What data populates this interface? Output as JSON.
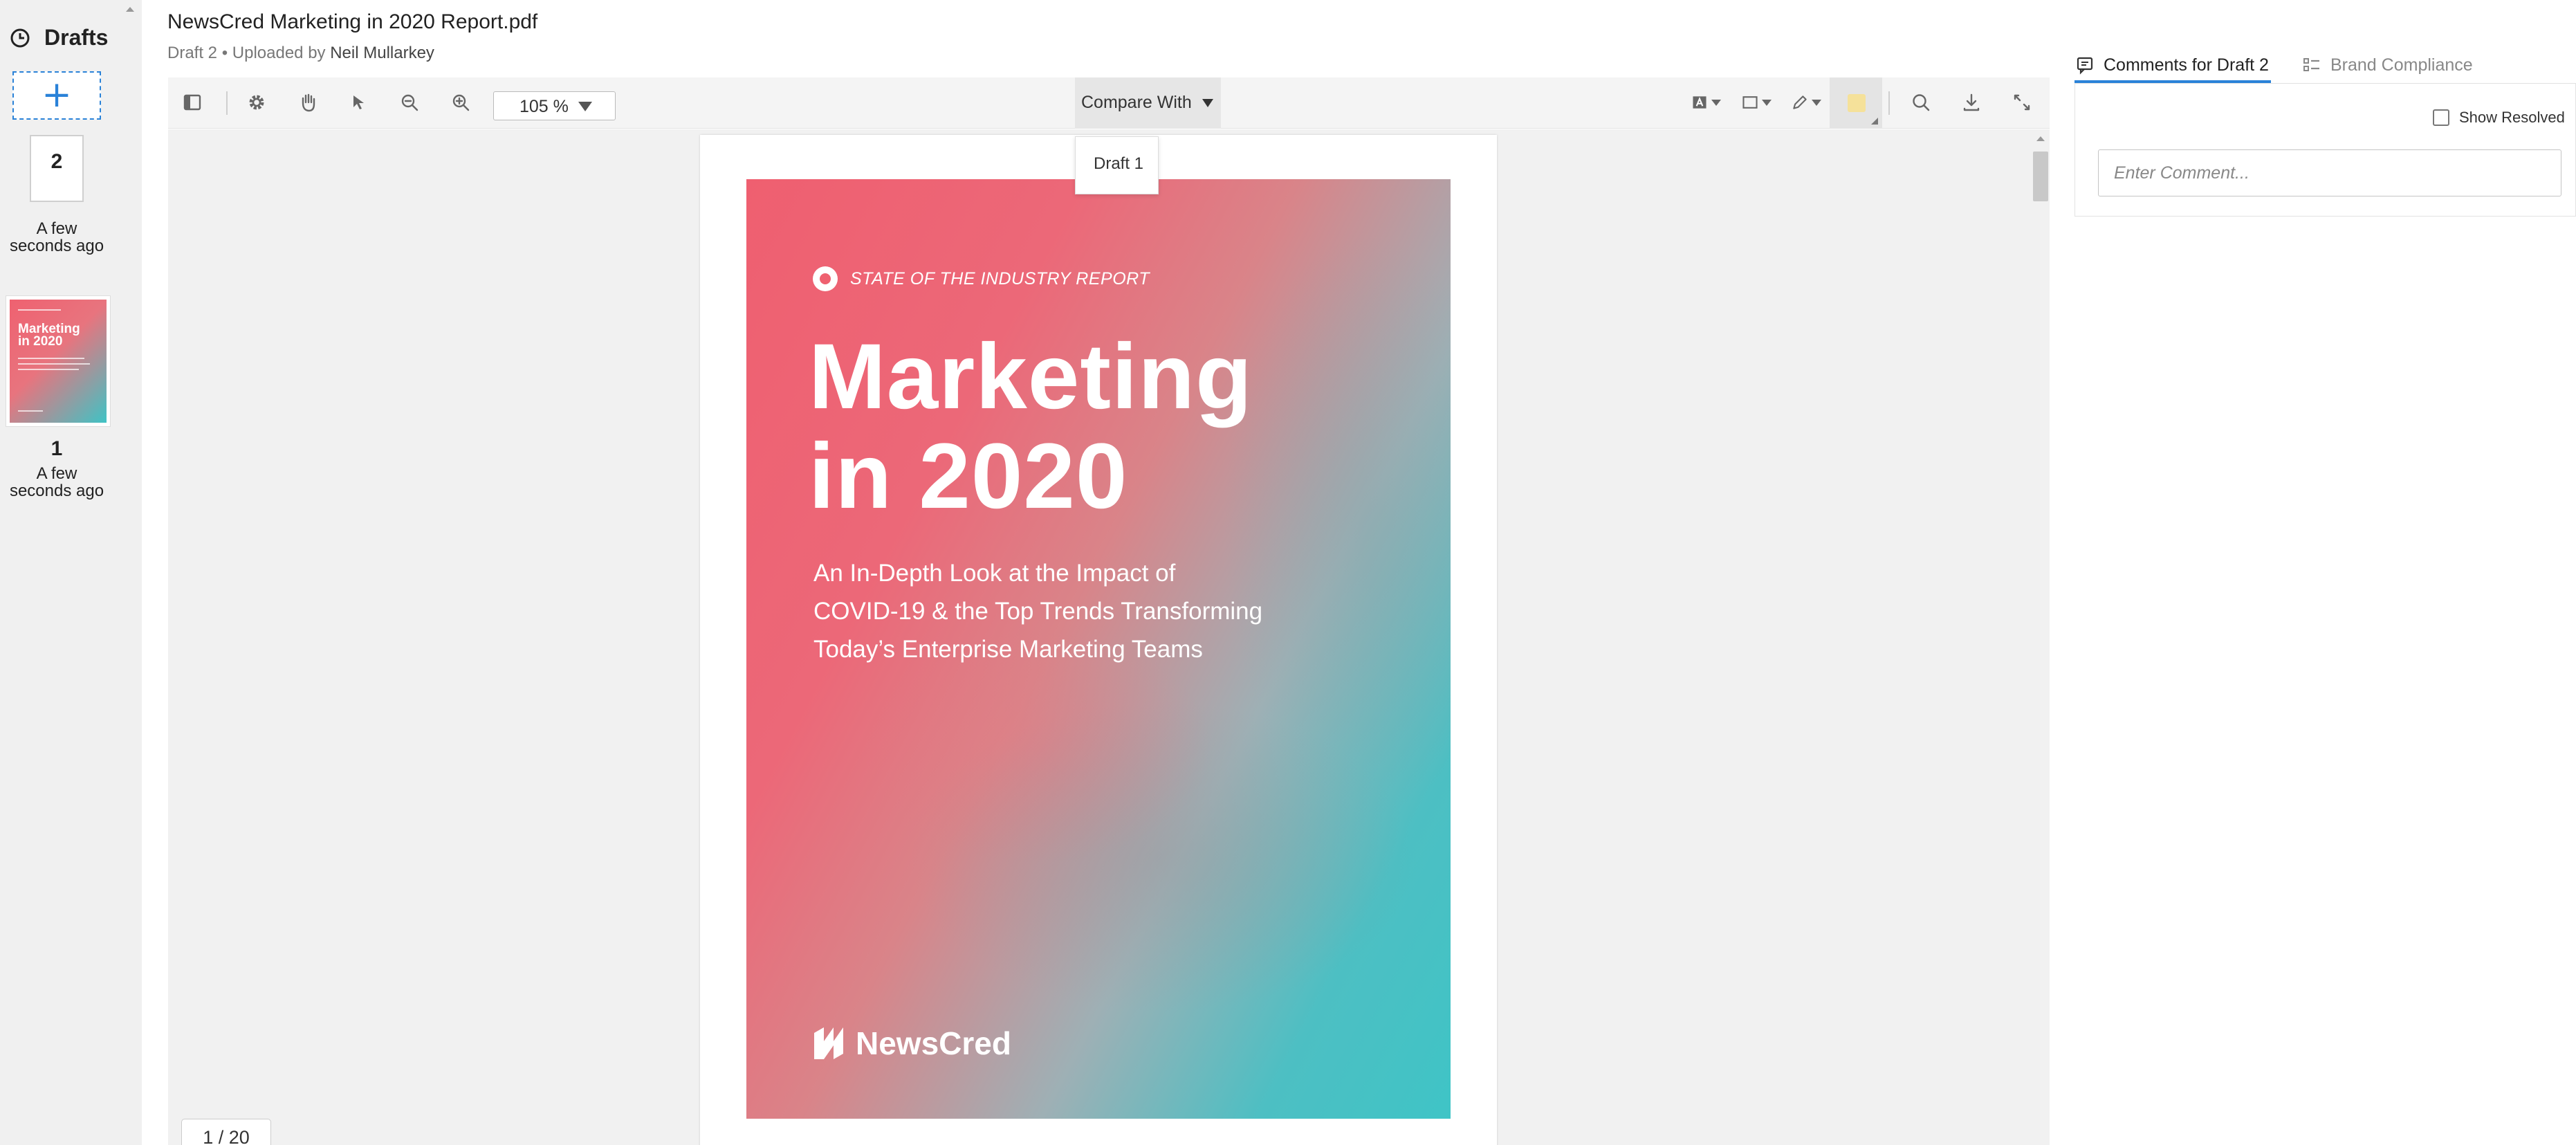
{
  "file": {
    "title": "NewsCred Marketing in 2020 Report.pdf",
    "draft_label": "Draft 2",
    "uploaded_by_prefix": "• Uploaded by",
    "uploader": "Neil Mullarkey"
  },
  "sidebar": {
    "title": "Drafts",
    "add_label": "+",
    "drafts": [
      {
        "number": "2",
        "time_line1": "A few",
        "time_line2": "seconds ago"
      },
      {
        "number": "1",
        "time_line1": "A few",
        "time_line2": "seconds ago"
      }
    ]
  },
  "toolbar": {
    "zoom": "105 %",
    "compare_label": "Compare With",
    "compare_options": [
      "Draft 1"
    ],
    "icons": [
      "sidebar-toggle-icon",
      "gear-icon",
      "hand-icon",
      "pointer-icon",
      "zoom-out-icon",
      "zoom-in-icon",
      "text-tool-icon",
      "shape-tool-icon",
      "pen-tool-icon",
      "highlight-icon",
      "search-icon",
      "download-icon",
      "fullscreen-icon"
    ]
  },
  "document": {
    "kicker": "STATE OF THE INDUSTRY REPORT",
    "headline_line1": "Marketing",
    "headline_line2": "in 2020",
    "subtitle_line1": "An In-Depth Look at the Impact of",
    "subtitle_line2": "COVID-19 & the Top Trends Transforming",
    "subtitle_line3": "Today’s Enterprise Marketing Teams",
    "brand": "NewsCred",
    "page_indicator": "1 / 20",
    "colors": {
      "cover_pink": "#ef6170",
      "cover_teal": "#3fc4c6"
    }
  },
  "comments": {
    "tab_comments": "Comments for Draft 2",
    "tab_brand": "Brand Compliance",
    "show_resolved": "Show Resolved",
    "input_placeholder": "Enter Comment..."
  },
  "colors": {
    "accent": "#2a82d8",
    "sidebar_bg": "#f0f0f0",
    "toolbar_bg": "#f4f4f4"
  }
}
